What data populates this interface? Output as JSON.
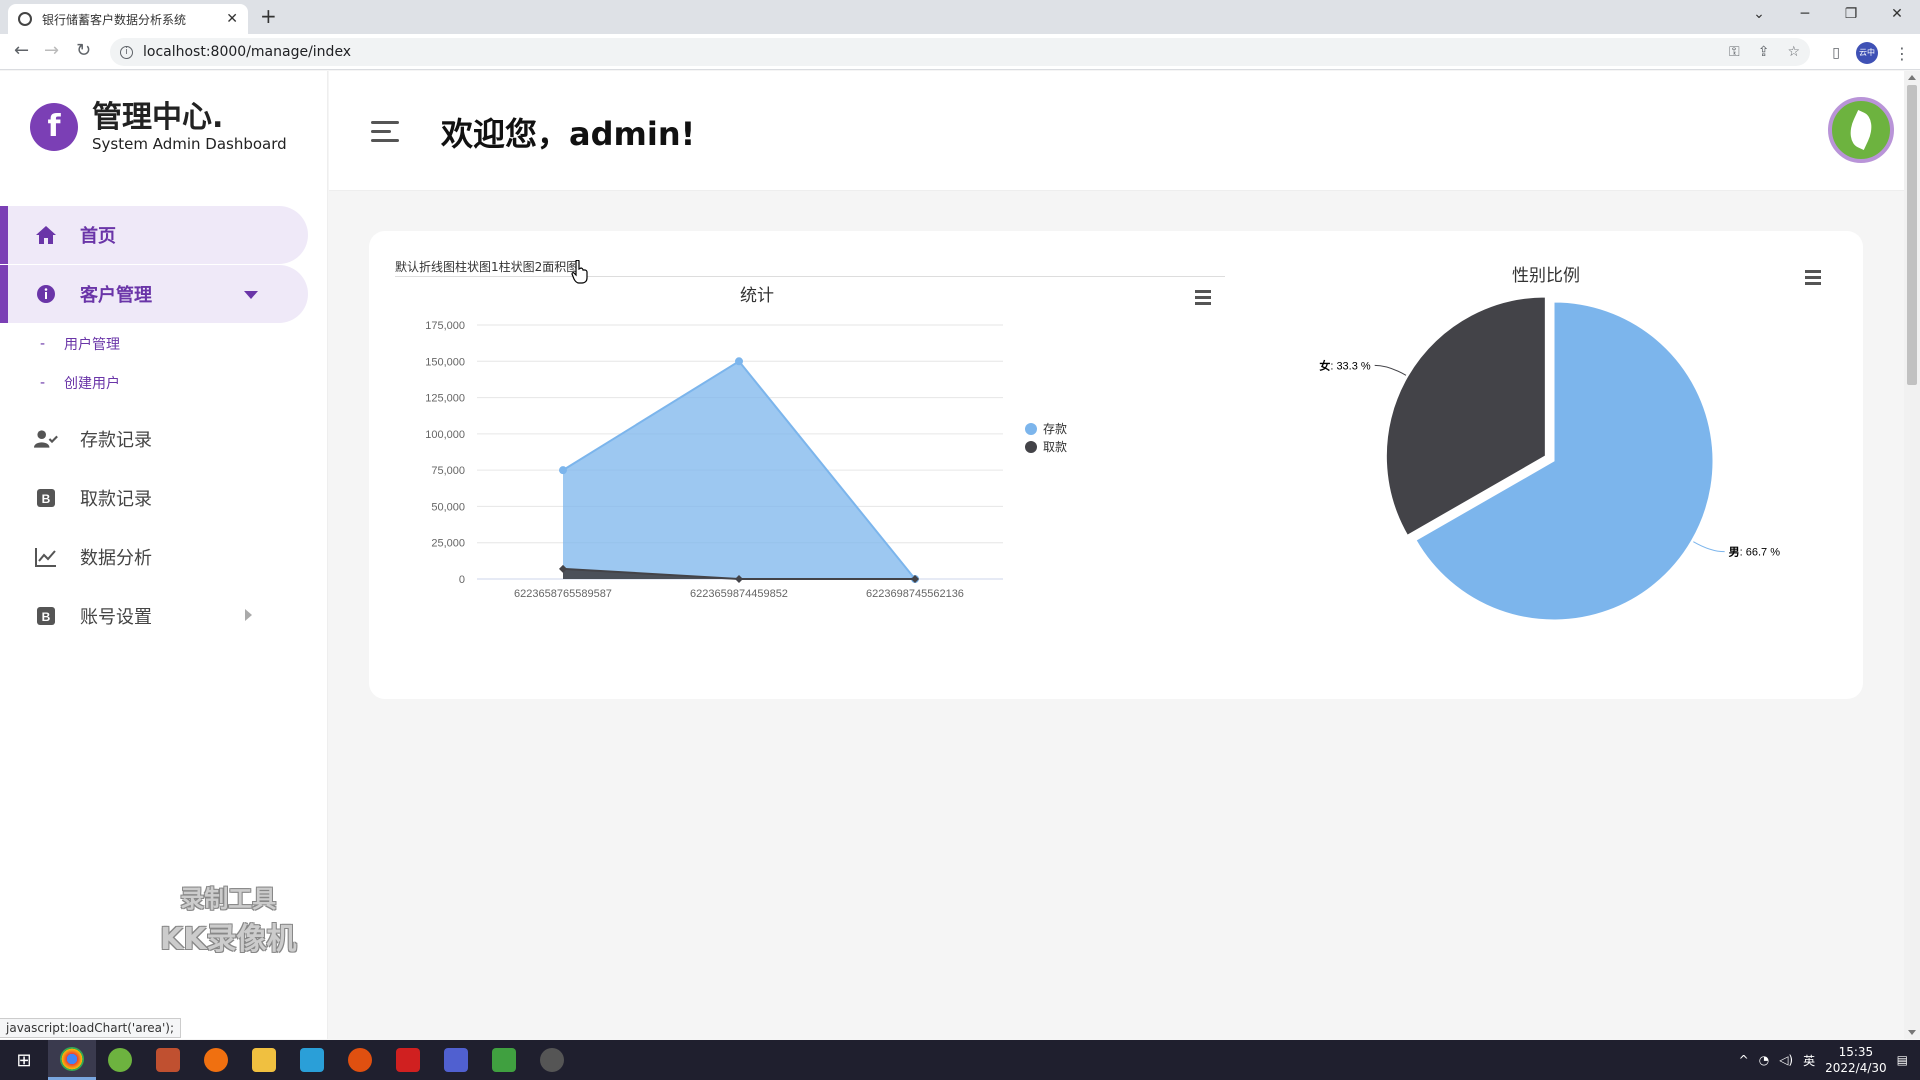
{
  "browser": {
    "tab_title": "银行储蓄客户数据分析系统",
    "tab_close": "✕",
    "new_tab": "+",
    "url": "localhost:8000/manage/index",
    "profile_label": "云中",
    "win_min": "─",
    "win_restore": "❐",
    "win_close": "✕"
  },
  "brand": {
    "logo_letter": "f",
    "title": "管理中心.",
    "subtitle": "System Admin Dashboard"
  },
  "sidebar": {
    "items": [
      {
        "label": "首页",
        "icon": "home-icon"
      },
      {
        "label": "客户管理",
        "icon": "info-icon"
      },
      {
        "label": "存款记录",
        "icon": "user-check-icon"
      },
      {
        "label": "取款记录",
        "icon": "b-square-icon"
      },
      {
        "label": "数据分析",
        "icon": "line-chart-icon"
      },
      {
        "label": "账号设置",
        "icon": "b-square-icon"
      }
    ],
    "subitems": [
      {
        "label": "用户管理"
      },
      {
        "label": "创建用户"
      }
    ],
    "sub_dash": "-"
  },
  "watermark": {
    "line1": "录制工具",
    "line2": "KK录像机"
  },
  "header": {
    "welcome": "欢迎您，admin!"
  },
  "chart_links": {
    "default_line": "默认折线图",
    "bar1": "柱状图1",
    "bar2": "柱状图2",
    "area": "面积图"
  },
  "status_bar": "javascript:loadChart('area');",
  "chart_data": [
    {
      "type": "area",
      "title": "统计",
      "categories": [
        "6223658765589587",
        "6223659874459852",
        "6223698745562136"
      ],
      "series": [
        {
          "name": "存款",
          "values": [
            75000,
            150000,
            0
          ],
          "color": "#7cb5ec"
        },
        {
          "name": "取款",
          "values": [
            7000,
            0,
            0
          ],
          "color": "#434348"
        }
      ],
      "ylim": [
        0,
        175000
      ],
      "yticks": [
        "0",
        "25,000",
        "50,000",
        "75,000",
        "100,000",
        "125,000",
        "150,000",
        "175,000"
      ],
      "legend": "right",
      "grid": true
    },
    {
      "type": "pie",
      "title": "性别比例",
      "slices": [
        {
          "name": "男",
          "value": 66.7,
          "label": "66.7 %",
          "color": "#7cb5ec"
        },
        {
          "name": "女",
          "value": 33.3,
          "label": "33.3 %",
          "color": "#434348"
        }
      ]
    }
  ],
  "taskbar": {
    "clock_time": "15:35",
    "clock_date": "2022/4/30",
    "ime": "英"
  }
}
